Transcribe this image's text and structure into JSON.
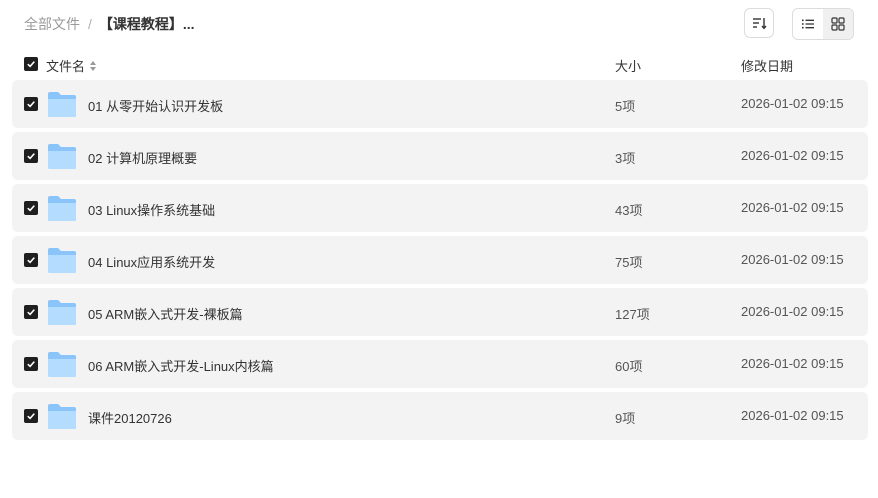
{
  "breadcrumb": {
    "root": "全部文件",
    "separator": "/",
    "current": "【课程教程】..."
  },
  "toolbar": {
    "sort_icon": "sort-icon",
    "list_view_icon": "list-view-icon",
    "grid_view_icon": "grid-view-icon",
    "active_view": "grid"
  },
  "header": {
    "name": "文件名",
    "size": "大小",
    "modified": "修改日期",
    "all_checked": true
  },
  "colors": {
    "row_bg": "#f3f3f3",
    "checkbox": "#1f1f1f",
    "folder_light": "#cde6ff",
    "folder_dark": "#6fb3f5"
  },
  "files": [
    {
      "name": "01 从零开始认识开发板",
      "size": "5项",
      "modified": "2026-01-02 09:15",
      "checked": true
    },
    {
      "name": "02 计算机原理概要",
      "size": "3项",
      "modified": "2026-01-02 09:15",
      "checked": true
    },
    {
      "name": "03 Linux操作系统基础",
      "size": "43项",
      "modified": "2026-01-02 09:15",
      "checked": true
    },
    {
      "name": "04 Linux应用系统开发",
      "size": "75项",
      "modified": "2026-01-02 09:15",
      "checked": true
    },
    {
      "name": "05 ARM嵌入式开发-裸板篇",
      "size": "127项",
      "modified": "2026-01-02 09:15",
      "checked": true
    },
    {
      "name": "06 ARM嵌入式开发-Linux内核篇",
      "size": "60项",
      "modified": "2026-01-02 09:15",
      "checked": true
    },
    {
      "name": "课件20120726",
      "size": "9项",
      "modified": "2026-01-02 09:15",
      "checked": true
    }
  ]
}
